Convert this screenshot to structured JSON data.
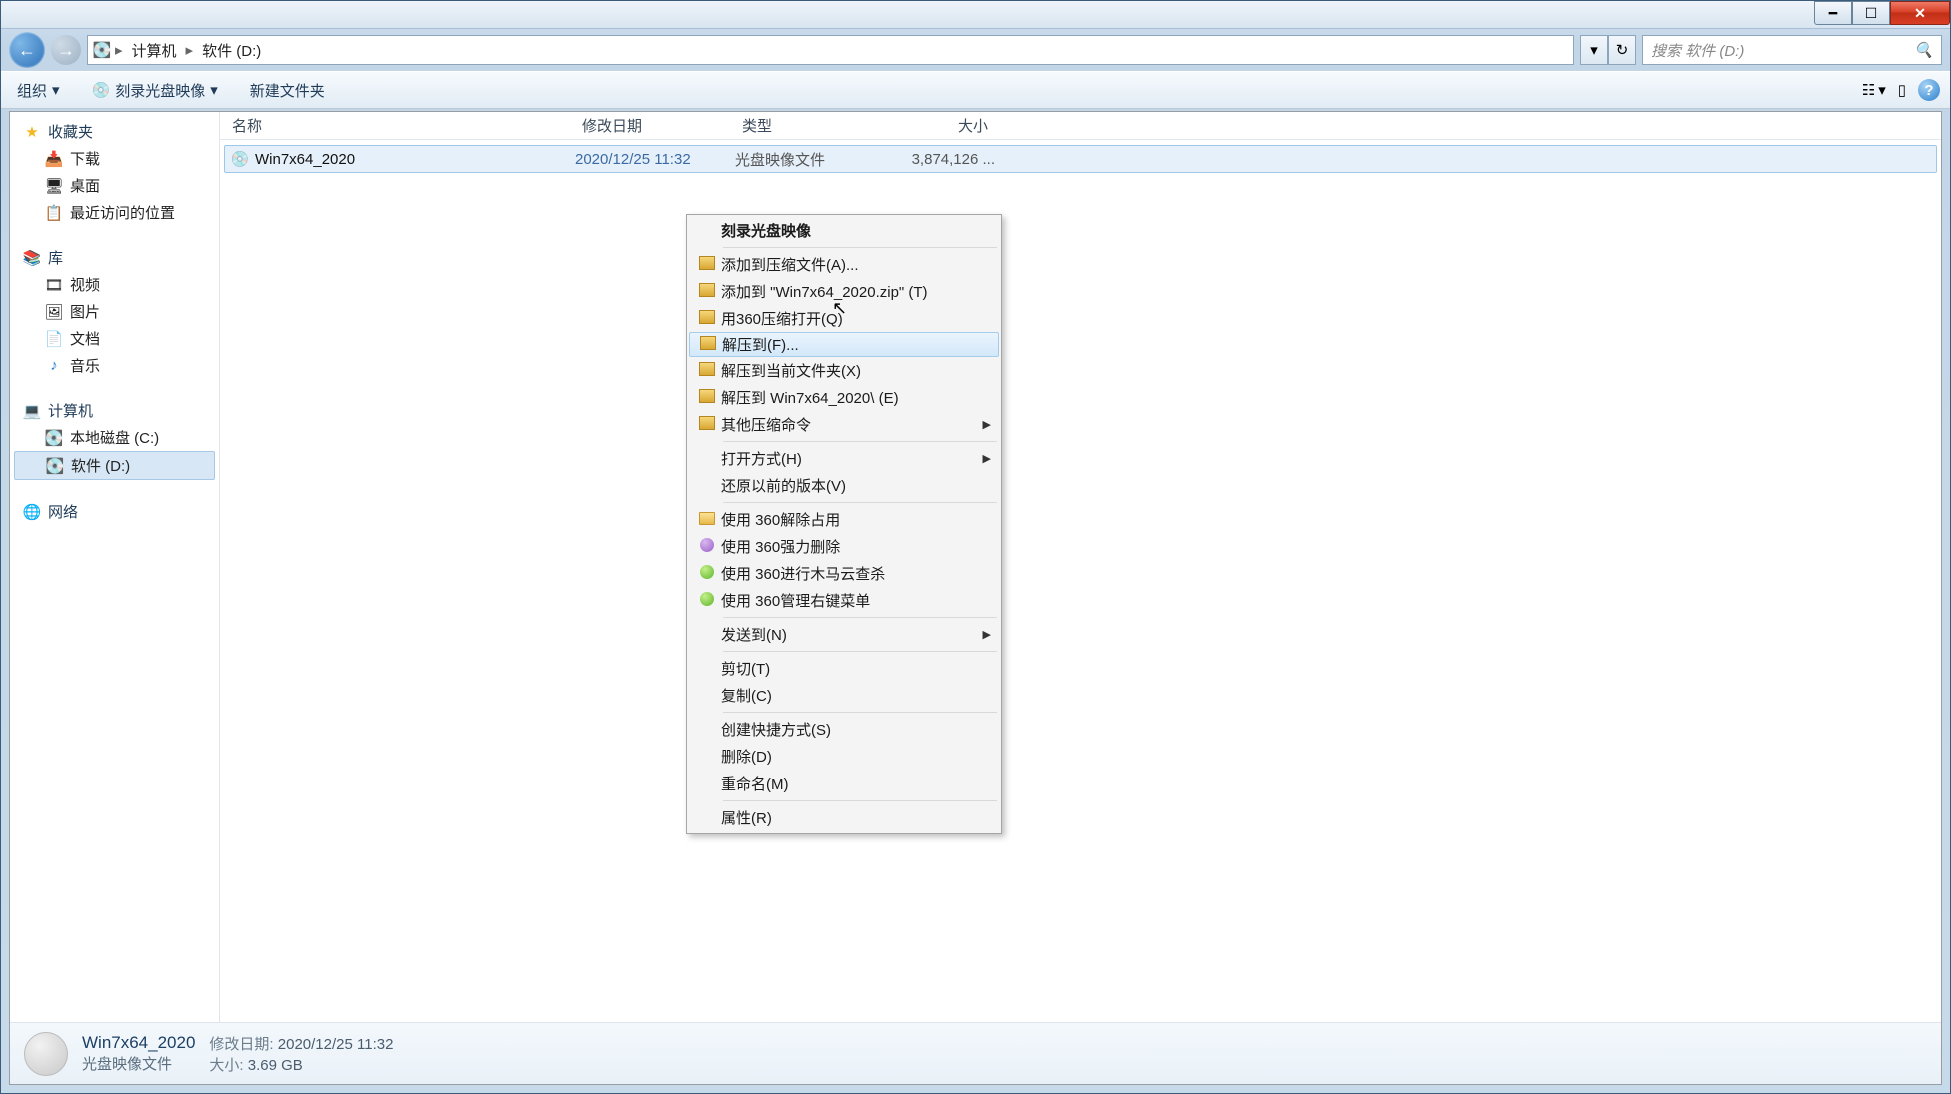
{
  "breadcrumb": {
    "computer": "计算机",
    "drive": "软件 (D:)"
  },
  "search": {
    "placeholder": "搜索 软件 (D:)"
  },
  "toolbar": {
    "organize": "组织",
    "burn": "刻录光盘映像",
    "newfolder": "新建文件夹"
  },
  "sidebar": {
    "fav": "收藏夹",
    "downloads": "下载",
    "desktop": "桌面",
    "recent": "最近访问的位置",
    "lib": "库",
    "video": "视频",
    "pictures": "图片",
    "docs": "文档",
    "music": "音乐",
    "computer": "计算机",
    "cdrive": "本地磁盘 (C:)",
    "ddrive": "软件 (D:)",
    "network": "网络"
  },
  "columns": {
    "name": "名称",
    "date": "修改日期",
    "type": "类型",
    "size": "大小"
  },
  "file": {
    "name": "Win7x64_2020",
    "date": "2020/12/25 11:32",
    "type": "光盘映像文件",
    "size": "3,874,126 ..."
  },
  "ctx": {
    "burn": "刻录光盘映像",
    "add_archive": "添加到压缩文件(A)...",
    "add_zip": "添加到 \"Win7x64_2020.zip\" (T)",
    "open_360": "用360压缩打开(Q)",
    "extract_to": "解压到(F)...",
    "extract_here": "解压到当前文件夹(X)",
    "extract_folder": "解压到 Win7x64_2020\\ (E)",
    "other_compress": "其他压缩命令",
    "open_with": "打开方式(H)",
    "restore_prev": "还原以前的版本(V)",
    "use_360_unlock": "使用 360解除占用",
    "use_360_delete": "使用 360强力删除",
    "use_360_scan": "使用 360进行木马云查杀",
    "use_360_menu": "使用 360管理右键菜单",
    "send_to": "发送到(N)",
    "cut": "剪切(T)",
    "copy": "复制(C)",
    "shortcut": "创建快捷方式(S)",
    "delete": "删除(D)",
    "rename": "重命名(M)",
    "properties": "属性(R)"
  },
  "details": {
    "name": "Win7x64_2020",
    "type": "光盘映像文件",
    "date_label": "修改日期:",
    "date": "2020/12/25 11:32",
    "size_label": "大小:",
    "size": "3.69 GB"
  }
}
